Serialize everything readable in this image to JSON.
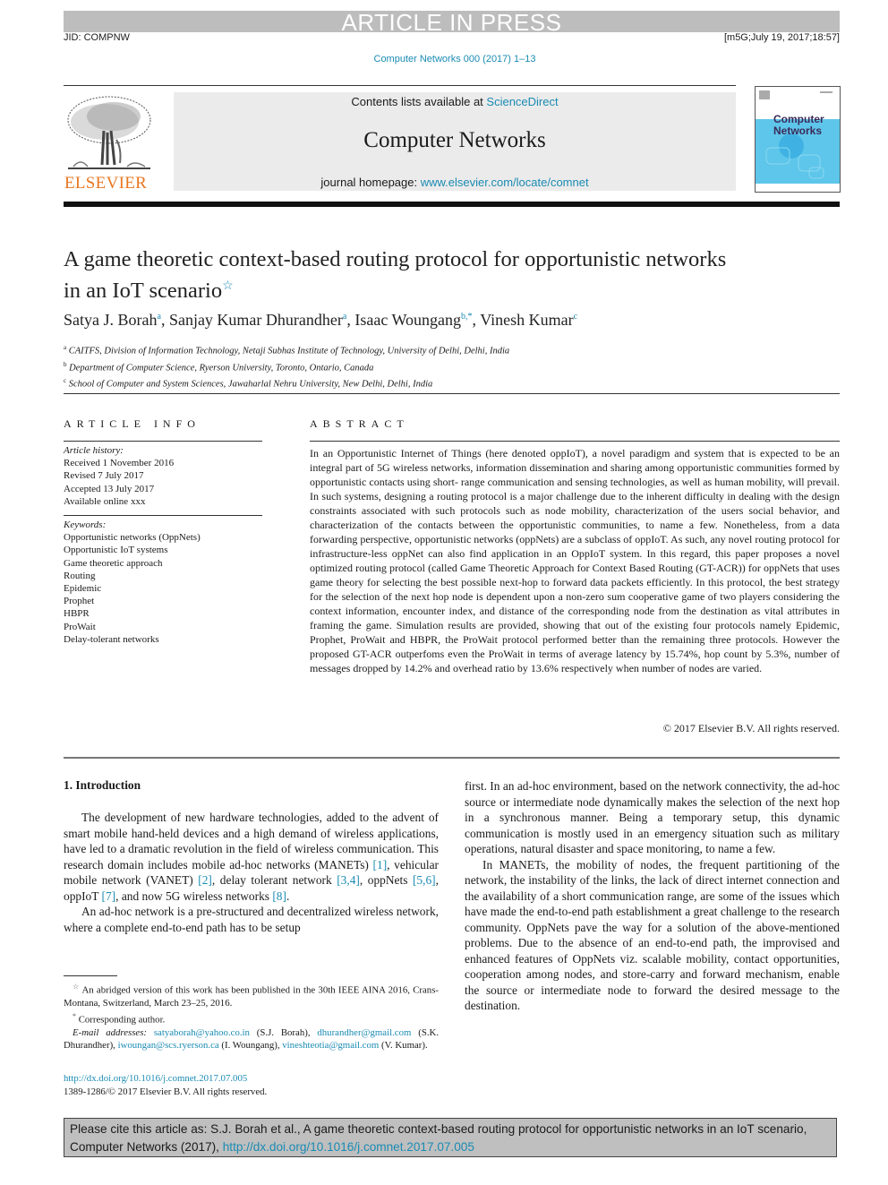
{
  "banner": {
    "article_in_press": "ARTICLE IN PRESS",
    "jid": "JID: COMPNW",
    "stamp": "[m5G;July 19, 2017;18:57]",
    "journal_citation": "Computer Networks 000 (2017) 1–13"
  },
  "masthead": {
    "publisher_logo_text": "ELSEVIER",
    "contents_prefix": "Contents lists available at ",
    "contents_link": "ScienceDirect",
    "journal_title": "Computer Networks",
    "homepage_prefix": "journal homepage: ",
    "homepage_link": "www.elsevier.com/locate/comnet",
    "cover_title_line1": "Computer",
    "cover_title_line2": "Networks"
  },
  "article": {
    "title": "A game theoretic context-based routing protocol for opportunistic networks in an IoT scenario",
    "title_note_symbol": "☆",
    "authors": [
      {
        "name": "Satya J. Borah",
        "sup": "a"
      },
      {
        "name": "Sanjay Kumar Dhurandher",
        "sup": "a"
      },
      {
        "name": "Isaac Woungang",
        "sup": "b,*"
      },
      {
        "name": "Vinesh Kumar",
        "sup": "c"
      }
    ],
    "affiliations": [
      {
        "sup": "a",
        "text": "CAITFS, Division of Information Technology, Netaji Subhas Institute of Technology, University of Delhi, Delhi, India"
      },
      {
        "sup": "b",
        "text": "Department of Computer Science, Ryerson University, Toronto, Ontario, Canada"
      },
      {
        "sup": "c",
        "text": "School of Computer and System Sciences, Jawaharlal Nehru University, New Delhi, Delhi, India"
      }
    ]
  },
  "article_info": {
    "heading": "ARTICLE INFO",
    "history_label": "Article history:",
    "history": [
      "Received 1 November 2016",
      "Revised 7 July 2017",
      "Accepted 13 July 2017",
      "Available online xxx"
    ],
    "keywords_label": "Keywords:",
    "keywords": [
      "Opportunistic networks (OppNets)",
      "Opportunistic IoT systems",
      "Game theoretic approach",
      "Routing",
      "Epidemic",
      "Prophet",
      "HBPR",
      "ProWait",
      "Delay-tolerant networks"
    ]
  },
  "abstract": {
    "heading": "ABSTRACT",
    "text": "In an Opportunistic Internet of Things (here denoted oppIoT), a novel paradigm and system that is expected to be an integral part of 5G wireless networks, information dissemination and sharing among opportunistic communities formed by opportunistic contacts using short- range communication and sensing technologies, as well as human mobility, will prevail. In such systems, designing a routing protocol is a major challenge due to the inherent difficulty in dealing with the design constraints associated with such protocols such as node mobility, characterization of the users social behavior, and characterization of the contacts between the opportunistic communities, to name a few. Nonetheless, from a data forwarding perspective, opportunistic networks (oppNets) are a subclass of oppIoT. As such, any novel routing protocol for infrastructure-less oppNet can also find application in an OppIoT system. In this regard, this paper proposes a novel optimized routing protocol (called Game Theoretic Approach for Context Based Routing (GT-ACR)) for oppNets that uses game theory for selecting the best possible next-hop to forward data packets efficiently. In this protocol, the best strategy for the selection of the next hop node is dependent upon a non-zero sum cooperative game of two players considering the context information, encounter index, and distance of the corresponding node from the destination as vital attributes in framing the game. Simulation results are provided, showing that out of the existing four protocols namely Epidemic, Prophet, ProWait and HBPR, the ProWait protocol performed better than the remaining three protocols. However the proposed GT-ACR outperfoms even the ProWait in terms of average latency by 15.74%, hop count by 5.3%, number of messages dropped by 14.2% and overhead ratio by 13.6% respectively when number of nodes are varied.",
    "copyright": "© 2017 Elsevier B.V. All rights reserved."
  },
  "intro": {
    "heading": "1. Introduction",
    "p1_a": "The development of new hardware technologies, added to the advent of smart mobile hand-held devices and a high demand of wireless applications, have led to a dramatic revolution in the field of wireless communication. This research domain includes mobile ad-hoc networks (MANETs) ",
    "ref1": "[1]",
    "p1_b": ", vehicular mobile network (VANET) ",
    "ref2": "[2]",
    "p1_c": ", delay tolerant network ",
    "ref3": "[3,4]",
    "p1_d": ", oppNets ",
    "ref4": "[5,6]",
    "p1_e": ", oppIoT ",
    "ref5": "[7]",
    "p1_f": ", and now 5G wireless networks ",
    "ref6": "[8]",
    "p1_g": ".",
    "p2": "An ad-hoc network is a pre-structured and decentralized wireless network, where a complete end-to-end path has to be setup",
    "p2_cont": "first. In an ad-hoc environment, based on the network connectivity, the ad-hoc source or intermediate node dynamically makes the selection of the next hop in a synchronous manner. Being a temporary setup, this dynamic communication is mostly used in an emergency situation such as military operations, natural disaster and space monitoring, to name a few.",
    "p3": "In MANETs, the mobility of nodes, the frequent partitioning of the network, the instability of the links, the lack of direct internet connection and the availability of a short communication range, are some of the issues which have made the end-to-end path establishment a great challenge to the research community. OppNets pave the way for a solution of the above-mentioned problems. Due to the absence of an end-to-end path, the improvised and enhanced features of OppNets viz. scalable mobility, contact opportunities, cooperation among nodes, and store-carry and forward mechanism, enable the source or intermediate node to forward the desired message to the destination."
  },
  "footnotes": {
    "star_symbol": "☆",
    "star_text": "An abridged version of this work has been published in the 30th IEEE AINA 2016, Crans-Montana, Switzerland, March 23–25, 2016.",
    "corr_symbol": "*",
    "corr_text": "Corresponding author.",
    "email_label": "E-mail addresses:",
    "emails": [
      {
        "email": "satyaborah@yahoo.co.in",
        "name": "(S.J. Borah)"
      },
      {
        "email": "dhurandher@gmail.com",
        "name": "(S.K. Dhurandher)"
      },
      {
        "email": "iwoungan@scs.ryerson.ca",
        "name": "(I. Woungang)"
      },
      {
        "email": "vineshteotia@gmail.com",
        "name": "(V. Kumar)."
      }
    ],
    "doi": "http://dx.doi.org/10.1016/j.comnet.2017.07.005",
    "issn_line": "1389-1286/© 2017 Elsevier B.V. All rights reserved."
  },
  "cite_box": {
    "text": "Please cite this article as: S.J. Borah et al., A game theoretic context-based routing protocol for opportunistic networks in an IoT scenario, Computer Networks (2017), ",
    "doi": "http://dx.doi.org/10.1016/j.comnet.2017.07.005"
  },
  "colors": {
    "link": "#1a8bb3",
    "elsevier_orange": "#e87722",
    "banner_grey": "#bdbdbd",
    "masthead_grey": "#ebebeb",
    "cover_blue": "#5ec6ea"
  }
}
